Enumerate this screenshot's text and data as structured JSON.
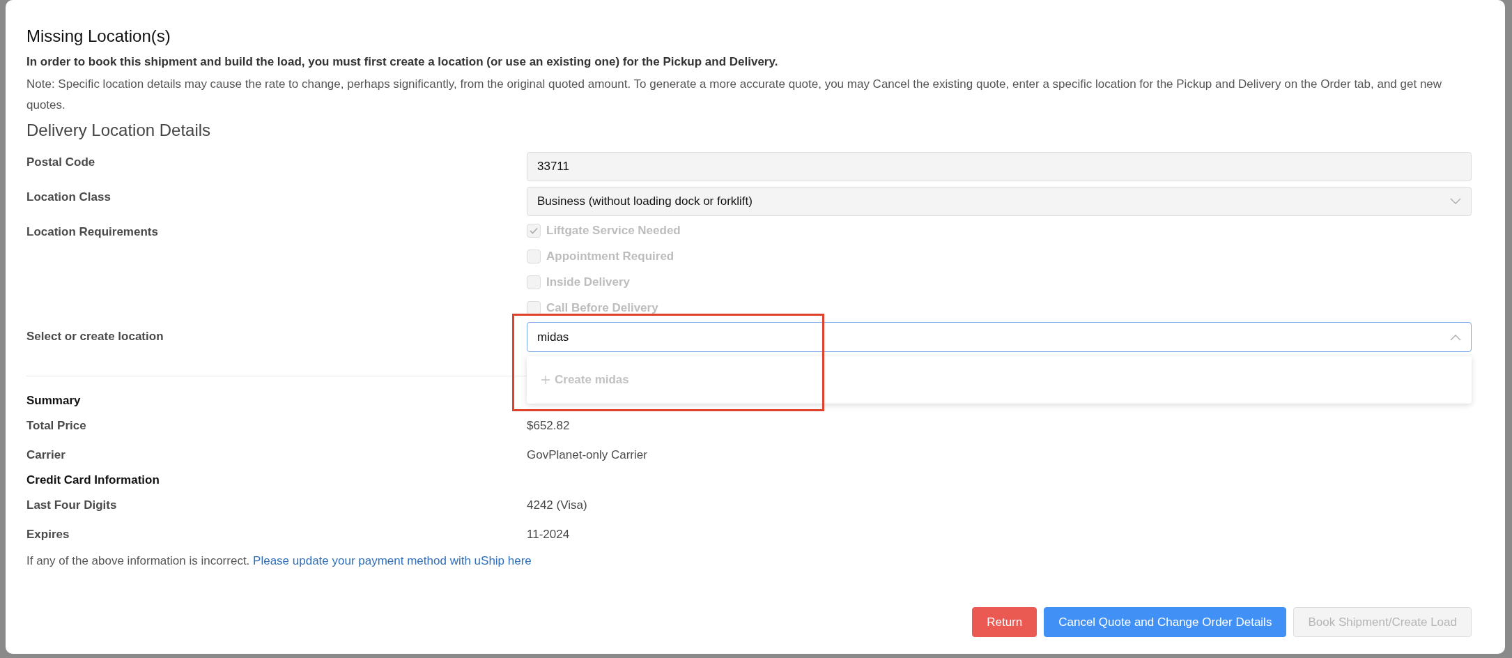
{
  "dialog": {
    "title": "Missing Location(s)",
    "intro": "In order to book this shipment and build the load, you must first create a location (or use an existing one) for the Pickup and Delivery.",
    "note": "Note: Specific location details may cause the rate to change, perhaps significantly, from the original quoted amount. To generate a more accurate quote, you may Cancel the existing quote, enter a specific location for the Pickup and Delivery on the Order tab, and get new quotes."
  },
  "delivery": {
    "heading": "Delivery Location Details",
    "postal_code": {
      "label": "Postal Code",
      "value": "33711"
    },
    "location_class": {
      "label": "Location Class",
      "value": "Business (without loading dock or forklift)"
    },
    "requirements": {
      "label": "Location Requirements",
      "options": [
        {
          "label": "Liftgate Service Needed",
          "checked": true,
          "disabled": true
        },
        {
          "label": "Appointment Required",
          "checked": false,
          "disabled": true
        },
        {
          "label": "Inside Delivery",
          "checked": false,
          "disabled": true
        },
        {
          "label": "Call Before Delivery",
          "checked": false,
          "disabled": true
        }
      ]
    },
    "location": {
      "label": "Select or create location",
      "value": "midas",
      "expanded": true,
      "options": [
        {
          "label": "Create midas",
          "disabled": true
        }
      ]
    }
  },
  "summary": {
    "heading": "Summary",
    "rows": [
      {
        "label": "Total Price",
        "value": "$652.82"
      },
      {
        "label": "Carrier",
        "value": "GovPlanet-only Carrier"
      }
    ]
  },
  "credit_card": {
    "heading": "Credit Card Information",
    "rows": [
      {
        "label": "Last Four Digits",
        "value": "4242 (Visa)"
      },
      {
        "label": "Expires",
        "value": "11-2024"
      }
    ]
  },
  "payment_note": {
    "text": "If any of the above information is incorrect.",
    "link": "Please update your payment method with uShip here"
  },
  "buttons": [
    {
      "label": "Return",
      "kind": "danger",
      "disabled": false
    },
    {
      "label": "Cancel Quote and Change Order Details",
      "kind": "primary",
      "disabled": false
    },
    {
      "label": "Book Shipment/Create Load",
      "kind": "default",
      "disabled": true
    }
  ]
}
